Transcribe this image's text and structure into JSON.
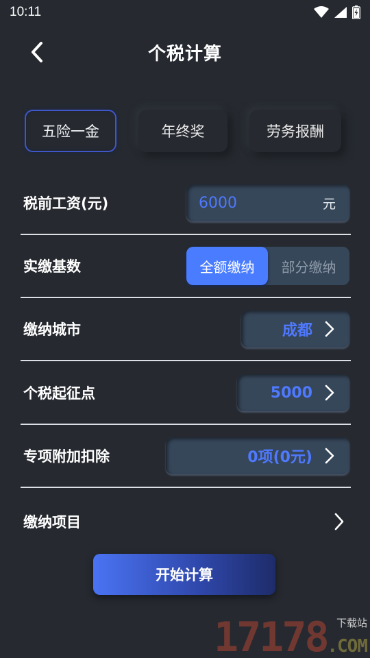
{
  "status_bar": {
    "time": "10:11"
  },
  "header": {
    "title": "个税计算"
  },
  "tabs": [
    {
      "label": "五险一金",
      "active": true
    },
    {
      "label": "年终奖",
      "active": false
    },
    {
      "label": "劳务报酬",
      "active": false
    }
  ],
  "form": {
    "salary": {
      "label": "税前工资(元)",
      "value": "6000",
      "unit": "元"
    },
    "base": {
      "label": "实缴基数",
      "options": [
        "全额缴纳",
        "部分缴纳"
      ],
      "selected": "全额缴纳"
    },
    "city": {
      "label": "缴纳城市",
      "value": "成都"
    },
    "threshold": {
      "label": "个税起征点",
      "value": "5000"
    },
    "deduction": {
      "label": "专项附加扣除",
      "value": "0项(0元)"
    },
    "items": {
      "label": "缴纳项目"
    }
  },
  "start_button": {
    "label": "开始计算"
  },
  "watermark": {
    "number": "17178",
    "site_suffix": ".COM",
    "tag": "下载站"
  },
  "colors": {
    "background": "#262a30",
    "accent": "#4f79ff",
    "field_bg": "#36475a",
    "tab_active_border": "#3f57c9"
  },
  "icons": {
    "back": "chevron-left-icon",
    "forward": "chevron-right-icon",
    "wifi": "wifi-icon",
    "signal": "signal-icon",
    "battery": "battery-icon"
  }
}
